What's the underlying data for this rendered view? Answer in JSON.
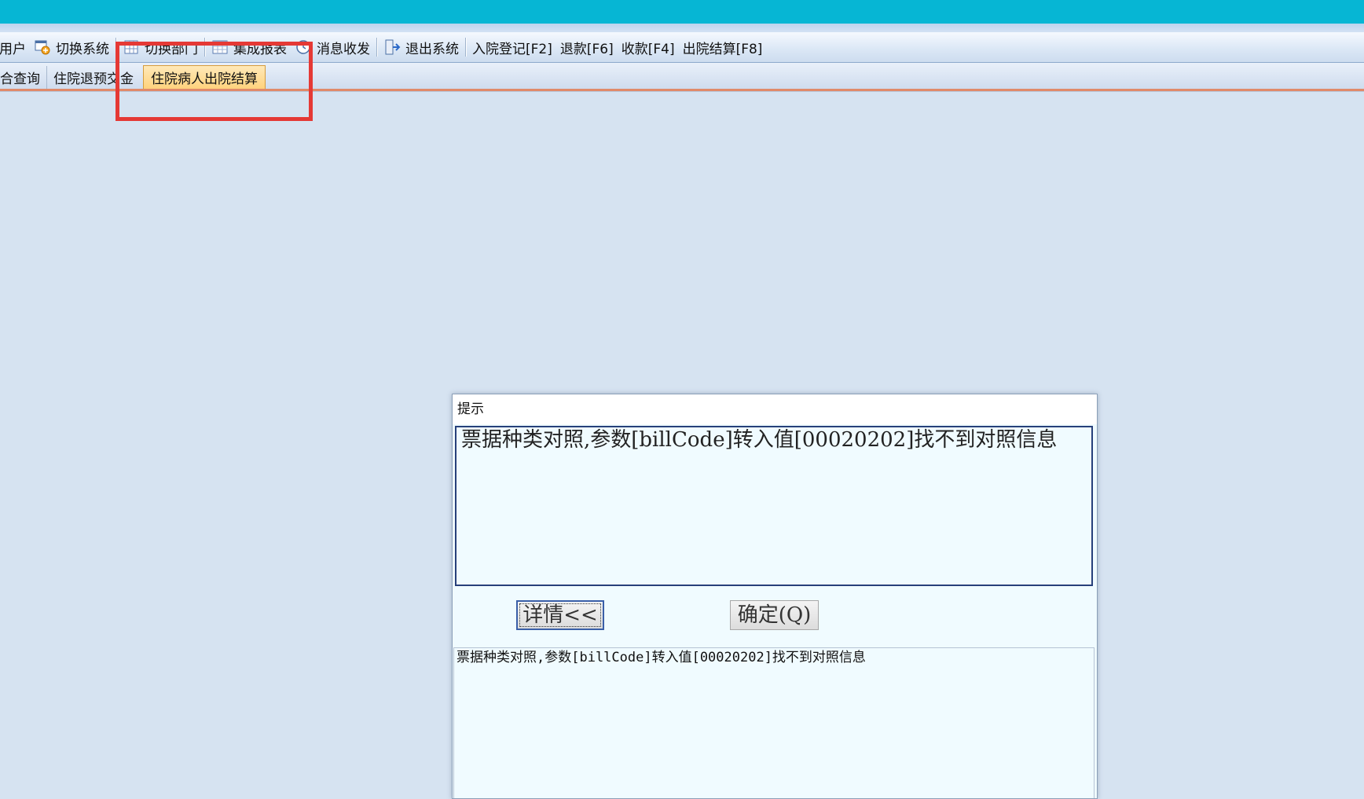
{
  "toolbar": {
    "items": [
      {
        "label": "用户",
        "icon": ""
      },
      {
        "label": "切换系统",
        "icon": "switch-system-icon"
      },
      {
        "label": "切换部门",
        "icon": "switch-department-icon"
      },
      {
        "label": "集成报表",
        "icon": "report-icon"
      },
      {
        "label": "消息收发",
        "icon": "message-icon"
      },
      {
        "label": "退出系统",
        "icon": "exit-icon"
      },
      {
        "label": "入院登记[F2]",
        "icon": ""
      },
      {
        "label": "退款[F6]",
        "icon": ""
      },
      {
        "label": "收款[F4]",
        "icon": ""
      },
      {
        "label": "出院结算[F8]",
        "icon": ""
      }
    ]
  },
  "tabs": {
    "items": [
      {
        "label": "合查询"
      },
      {
        "label": "住院退预交金"
      },
      {
        "label": "住院病人出院结算"
      }
    ],
    "active_index": 2
  },
  "dialog": {
    "title": "提示",
    "message": "票据种类对照,参数[billCode]转入值[00020202]找不到对照信息",
    "detail_button_label": "详情<<",
    "ok_button_label": "确定(Q)",
    "detail_text": "票据种类对照,参数[billCode]转入值[00020202]找不到对照信息"
  },
  "colors": {
    "titlebar": "#06b6d4",
    "active_tab": "#ffd27d",
    "highlight": "#e53935",
    "dialog_bg": "#f0fbff"
  }
}
